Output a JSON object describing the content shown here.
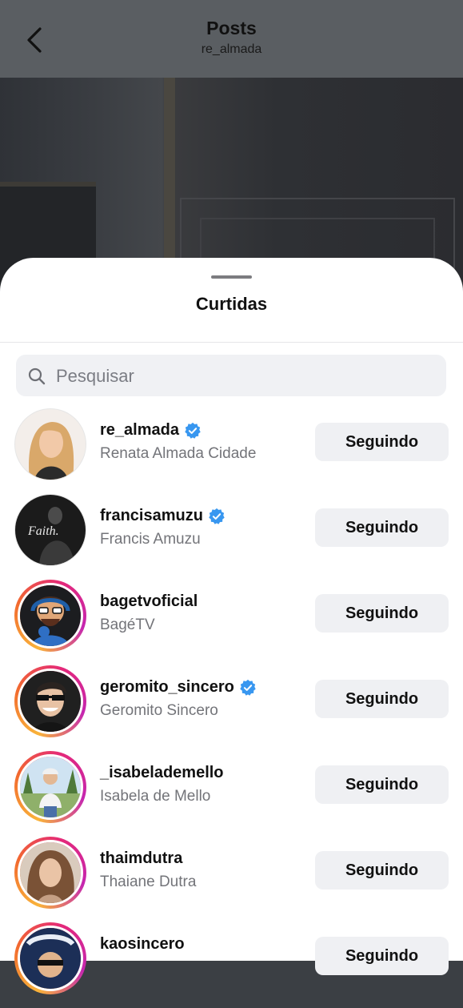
{
  "header": {
    "title": "Posts",
    "subtitle": "re_almada"
  },
  "sheet": {
    "title": "Curtidas",
    "search_placeholder": "Pesquisar"
  },
  "users": [
    {
      "username": "re_almada",
      "full_name": "Renata Almada Cidade",
      "verified": true,
      "button": "Seguindo",
      "story_ring": false
    },
    {
      "username": "francisamuzu",
      "full_name": "Francis Amuzu",
      "verified": true,
      "button": "Seguindo",
      "story_ring": false
    },
    {
      "username": "bagetvoficial",
      "full_name": "BagéTV",
      "verified": false,
      "button": "Seguindo",
      "story_ring": true
    },
    {
      "username": "geromito_sincero",
      "full_name": "Geromito Sincero",
      "verified": true,
      "button": "Seguindo",
      "story_ring": true
    },
    {
      "username": "_isabelademello",
      "full_name": "Isabela de Mello",
      "verified": false,
      "button": "Seguindo",
      "story_ring": true
    },
    {
      "username": "thaimdutra",
      "full_name": "Thaiane Dutra",
      "verified": false,
      "button": "Seguindo",
      "story_ring": true
    },
    {
      "username": "kaosincero",
      "full_name": "",
      "verified": false,
      "button": "Seguindo",
      "story_ring": true
    }
  ],
  "colors": {
    "verified_blue": "#3897f0",
    "button_bg": "#eff0f3",
    "secondary_text": "#737479"
  }
}
